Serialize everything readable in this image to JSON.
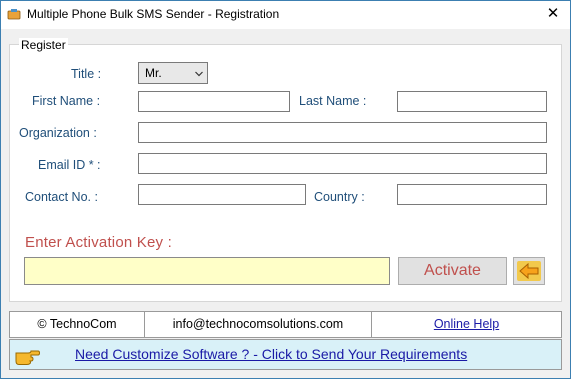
{
  "window": {
    "title": "Multiple Phone Bulk SMS Sender - Registration",
    "close_glyph": "✕"
  },
  "register": {
    "legend": "Register",
    "title_label": "Title :",
    "title_value": "Mr.",
    "first_name_label": "First Name :",
    "first_name_value": "",
    "last_name_label": "Last Name :",
    "last_name_value": "",
    "organization_label": "Organization :",
    "organization_value": "",
    "email_label": "Email ID * :",
    "email_value": "",
    "contact_label": "Contact No. :",
    "contact_value": "",
    "country_label": "Country :",
    "country_value": ""
  },
  "activation": {
    "label": "Enter Activation Key  :",
    "key_value": "",
    "activate_label": "Activate"
  },
  "footer": {
    "copyright": "© TechnoCom",
    "email": "info@technocomsolutions.com",
    "help_link": "Online Help"
  },
  "bottom": {
    "requirements_link": "Need Customize Software ? - Click to Send Your Requirements"
  },
  "icons": {
    "app": "sms-app-icon",
    "close": "close-icon",
    "dropdown": "chevron-down-icon",
    "back": "back-arrow-icon",
    "hand": "pointing-hand-icon"
  },
  "colors": {
    "label_blue": "#1f4e79",
    "activation_red": "#c0504d",
    "key_field_yellow": "#ffffc8",
    "link_blue": "#1a1aa6",
    "bottom_bar": "#d9f1f8"
  }
}
